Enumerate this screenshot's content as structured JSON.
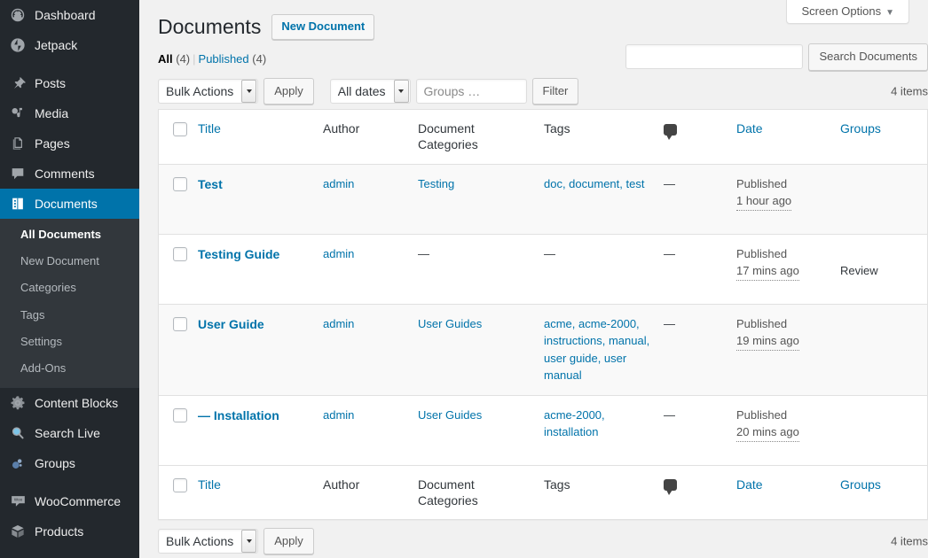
{
  "sidebar": {
    "items": [
      {
        "label": "Dashboard",
        "icon": "dashboard-icon",
        "name": "sidebar-item-dashboard"
      },
      {
        "label": "Jetpack",
        "icon": "jetpack-icon",
        "name": "sidebar-item-jetpack"
      },
      {
        "label": "Posts",
        "icon": "pin-icon",
        "name": "sidebar-item-posts"
      },
      {
        "label": "Media",
        "icon": "media-icon",
        "name": "sidebar-item-media"
      },
      {
        "label": "Pages",
        "icon": "pages-icon",
        "name": "sidebar-item-pages"
      },
      {
        "label": "Comments",
        "icon": "comment-icon",
        "name": "sidebar-item-comments"
      },
      {
        "label": "Documents",
        "icon": "documents-icon",
        "name": "sidebar-item-documents",
        "current": true
      },
      {
        "label": "Content Blocks",
        "icon": "gear-icon",
        "name": "sidebar-item-content-blocks"
      },
      {
        "label": "Search Live",
        "icon": "search-icon",
        "name": "sidebar-item-search-live"
      },
      {
        "label": "Groups",
        "icon": "groups-icon",
        "name": "sidebar-item-groups"
      },
      {
        "label": "WooCommerce",
        "icon": "woocommerce-icon",
        "name": "sidebar-item-woocommerce"
      },
      {
        "label": "Products",
        "icon": "products-icon",
        "name": "sidebar-item-products"
      }
    ],
    "submenu": [
      {
        "label": "All Documents",
        "current": true,
        "name": "submenu-item-all-documents"
      },
      {
        "label": "New Document",
        "current": false,
        "name": "submenu-item-new-document"
      },
      {
        "label": "Categories",
        "current": false,
        "name": "submenu-item-categories"
      },
      {
        "label": "Tags",
        "current": false,
        "name": "submenu-item-tags"
      },
      {
        "label": "Settings",
        "current": false,
        "name": "submenu-item-settings"
      },
      {
        "label": "Add-Ons",
        "current": false,
        "name": "submenu-item-add-ons"
      }
    ],
    "colors": {
      "background": "#23282d",
      "submenu_background": "#32373c",
      "current_background": "#0073aa"
    }
  },
  "screen_options": {
    "label": "Screen Options",
    "arrow": "▼"
  },
  "header": {
    "title": "Documents",
    "new_button": "New Document"
  },
  "search": {
    "value": "",
    "placeholder": "",
    "button": "Search Documents"
  },
  "views": {
    "all_label": "All",
    "all_count": "(4)",
    "separator": "|",
    "published_label": "Published",
    "published_count": "(4)"
  },
  "tablenav_top": {
    "bulk_actions": "Bulk Actions",
    "apply": "Apply",
    "date_filter": "All dates",
    "groups_placeholder": "Groups …",
    "groups_value": "",
    "filter": "Filter",
    "displaying_num": "4 items"
  },
  "tablenav_bottom": {
    "bulk_actions": "Bulk Actions",
    "apply": "Apply",
    "displaying_num": "4 items"
  },
  "table": {
    "columns": [
      {
        "key": "cb",
        "label": "",
        "link": false
      },
      {
        "key": "title",
        "label": "Title",
        "link": true
      },
      {
        "key": "author",
        "label": "Author",
        "link": false
      },
      {
        "key": "categories",
        "label": "Document Categories",
        "link": false
      },
      {
        "key": "tags",
        "label": "Tags",
        "link": false
      },
      {
        "key": "comments",
        "label": "comment-bubble-icon",
        "link": false
      },
      {
        "key": "date",
        "label": "Date",
        "link": true
      },
      {
        "key": "groups",
        "label": "Groups",
        "link": true
      }
    ],
    "rows": [
      {
        "title": "Test",
        "title_prefix": "",
        "author": "admin",
        "categories": "Testing",
        "tags": "doc, document, test",
        "comments": "—",
        "date_status": "Published",
        "date_ago": "1 hour ago",
        "groups": ""
      },
      {
        "title": "Testing Guide",
        "title_prefix": "",
        "author": "admin",
        "categories": "—",
        "tags": "—",
        "comments": "—",
        "date_status": "Published",
        "date_ago": "17 mins ago",
        "groups": "Review"
      },
      {
        "title": "User Guide",
        "title_prefix": "",
        "author": "admin",
        "categories": "User Guides",
        "tags": "acme, acme-2000, instructions, manual, user guide, user manual",
        "comments": "—",
        "date_status": "Published",
        "date_ago": "19 mins ago",
        "groups": ""
      },
      {
        "title": "Installation",
        "title_prefix": "— ",
        "author": "admin",
        "categories": "User Guides",
        "tags": "acme-2000, installation",
        "comments": "—",
        "date_status": "Published",
        "date_ago": "20 mins ago",
        "groups": ""
      }
    ]
  },
  "colors": {
    "link": "#0073aa",
    "admin_bg": "#23282d",
    "page_bg": "#f1f1f1",
    "row_alt": "#f9f9f9"
  }
}
